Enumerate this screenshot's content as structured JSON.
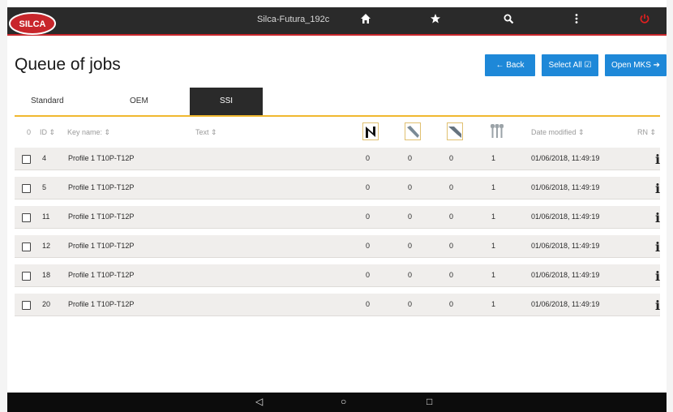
{
  "app": {
    "device_name": "Silca-Futura_192c",
    "brand_colors": {
      "red": "#c8262b",
      "accent_blue": "#1e88d8",
      "tab_underline": "#f0b830"
    },
    "toolbar_icons": [
      "home-icon",
      "star-icon",
      "search-icon",
      "more-vertical-icon",
      "power-icon"
    ]
  },
  "page": {
    "title": "Queue of jobs",
    "buttons": {
      "back": "← Back",
      "select_all": "Select All ☑",
      "open_mks": "Open MKS ➔"
    }
  },
  "tabs": [
    {
      "label": "Standard",
      "selected": false
    },
    {
      "label": "OEM",
      "selected": false
    },
    {
      "label": "SSI",
      "selected": true
    }
  ],
  "table": {
    "headers": {
      "check": "0",
      "id": "ID ⇕",
      "key_name": "Key name: ⇕",
      "text": "Text ⇕",
      "date": "Date modified ⇕",
      "rn": "RN ⇕"
    },
    "column_icons": [
      "key-profile-a-icon",
      "key-blade-icon",
      "key-blade-alt-icon",
      "key-set-icon"
    ],
    "rows": [
      {
        "id": "4",
        "key_name": "Profile 1 T10P-T12P",
        "text": "",
        "n1": "0",
        "n2": "0",
        "n3": "0",
        "n4": "1",
        "date": "01/06/2018, 11:49:19"
      },
      {
        "id": "5",
        "key_name": "Profile 1 T10P-T12P",
        "text": "",
        "n1": "0",
        "n2": "0",
        "n3": "0",
        "n4": "1",
        "date": "01/06/2018, 11:49:19"
      },
      {
        "id": "11",
        "key_name": "Profile 1 T10P-T12P",
        "text": "",
        "n1": "0",
        "n2": "0",
        "n3": "0",
        "n4": "1",
        "date": "01/06/2018, 11:49:19"
      },
      {
        "id": "12",
        "key_name": "Profile 1 T10P-T12P",
        "text": "",
        "n1": "0",
        "n2": "0",
        "n3": "0",
        "n4": "1",
        "date": "01/06/2018, 11:49:19"
      },
      {
        "id": "18",
        "key_name": "Profile 1 T10P-T12P",
        "text": "",
        "n1": "0",
        "n2": "0",
        "n3": "0",
        "n4": "1",
        "date": "01/06/2018, 11:49:19"
      },
      {
        "id": "20",
        "key_name": "Profile 1 T10P-T12P",
        "text": "",
        "n1": "0",
        "n2": "0",
        "n3": "0",
        "n4": "1",
        "date": "01/06/2018, 11:49:19"
      }
    ]
  },
  "android_nav": {
    "back": "◁",
    "home": "○",
    "recents": "□"
  }
}
